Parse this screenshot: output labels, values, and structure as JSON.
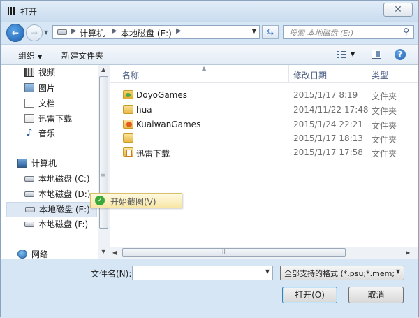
{
  "window": {
    "title": "打开",
    "close_glyph": "✕"
  },
  "navigation": {
    "breadcrumbs": [
      "计算机",
      "本地磁盘 (E:)"
    ],
    "search_placeholder": "搜索 本地磁盘 (E:)"
  },
  "toolbar": {
    "organize_label": "组织",
    "new_folder_label": "新建文件夹"
  },
  "sidebar": {
    "favorites": [
      {
        "label": "视频",
        "icon": "video-icon"
      },
      {
        "label": "图片",
        "icon": "picture-icon"
      },
      {
        "label": "文档",
        "icon": "document-icon"
      },
      {
        "label": "迅雷下载",
        "icon": "thunder-download-icon"
      },
      {
        "label": "音乐",
        "icon": "music-icon"
      }
    ],
    "computer": {
      "label": "计算机",
      "drives": [
        {
          "label": "本地磁盘 (C:)"
        },
        {
          "label": "本地磁盘 (D:)"
        },
        {
          "label": "本地磁盘 (E:)",
          "selected": true
        },
        {
          "label": "本地磁盘 (F:)"
        }
      ]
    },
    "network_label": "网络"
  },
  "columns": {
    "name": "名称",
    "modified": "修改日期",
    "type": "类型"
  },
  "files": [
    {
      "name": "DoyoGames",
      "modified": "2015/1/17 8:19",
      "type": "文件夹",
      "icon": "doyogames-folder-icon"
    },
    {
      "name": "hua",
      "modified": "2014/11/22 17:48",
      "type": "文件夹",
      "icon": "folder-icon"
    },
    {
      "name": "KuaiwanGames",
      "modified": "2015/1/24 22:21",
      "type": "文件夹",
      "icon": "kuaiwan-folder-icon"
    },
    {
      "name": "",
      "modified": "2015/1/17 18:13",
      "type": "文件夹",
      "icon": "folder-icon"
    },
    {
      "name": "迅雷下载",
      "modified": "2015/1/17 17:58",
      "type": "文件夹",
      "icon": "thunder-folder-icon"
    }
  ],
  "tooltip": {
    "text": "开始截图(V)"
  },
  "footer": {
    "filename_label": "文件名(N):",
    "filename_value": "",
    "filetype_selected": "全部支持的格式 (*.psu;*.mem;",
    "open_label": "打开(O)",
    "cancel_label": "取消"
  },
  "colors": {
    "accent": "#1b5fae",
    "selection": "#dde8f4",
    "window_frame": "#d6e6f5"
  }
}
